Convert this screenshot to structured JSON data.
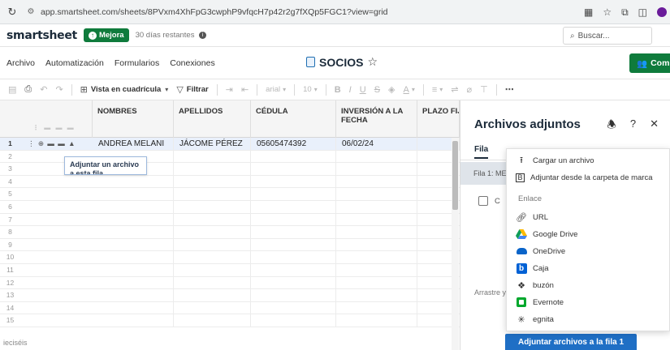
{
  "browser": {
    "reload_icon": "reload-icon",
    "url": "app.smartsheet.com/sheets/8PVxm4XhFpG3cwphP9vfqcH7p42r2g7fXQp5FGC1?view=grid"
  },
  "app": {
    "logo": "smartsheet",
    "upgrade_label": "Mejora",
    "trial_text": "30 días restantes",
    "search_placeholder": "Buscar..."
  },
  "menu": {
    "items": [
      "Archivo",
      "Automatización",
      "Formularios",
      "Conexiones"
    ],
    "sheet_title": "SOCIOS",
    "share_label": "Com"
  },
  "toolbar": {
    "view_label": "Vista en cuadrícula",
    "filter_label": "Filtrar",
    "font_name": "arial",
    "font_size": "10"
  },
  "grid": {
    "columns": [
      "NOMBRES",
      "APELLIDOS",
      "CÉDULA",
      "INVERSIÓN A LA FECHA",
      "PLAZO FIJO"
    ],
    "rows": [
      {
        "num": "1",
        "cells": [
          "ANDREA MELANI",
          "JÁCOME PÉREZ",
          "05605474392",
          "06/02/24",
          ""
        ]
      },
      {
        "num": "2",
        "cells": [
          "",
          "",
          "",
          "",
          ""
        ]
      },
      {
        "num": "3",
        "cells": [
          "",
          "",
          "",
          "",
          ""
        ]
      },
      {
        "num": "4",
        "cells": [
          "",
          "",
          "",
          "",
          ""
        ]
      },
      {
        "num": "5",
        "cells": [
          "",
          "",
          "",
          "",
          ""
        ]
      },
      {
        "num": "6",
        "cells": [
          "",
          "",
          "",
          "",
          ""
        ]
      },
      {
        "num": "7",
        "cells": [
          "",
          "",
          "",
          "",
          ""
        ]
      },
      {
        "num": "8",
        "cells": [
          "",
          "",
          "",
          "",
          ""
        ]
      },
      {
        "num": "9",
        "cells": [
          "",
          "",
          "",
          "",
          ""
        ]
      },
      {
        "num": "10",
        "cells": [
          "",
          "",
          "",
          "",
          ""
        ]
      },
      {
        "num": "11",
        "cells": [
          "",
          "",
          "",
          "",
          ""
        ]
      },
      {
        "num": "12",
        "cells": [
          "",
          "",
          "",
          "",
          ""
        ]
      },
      {
        "num": "13",
        "cells": [
          "",
          "",
          "",
          "",
          ""
        ]
      },
      {
        "num": "14",
        "cells": [
          "",
          "",
          "",
          "",
          ""
        ]
      },
      {
        "num": "15",
        "cells": [
          "",
          "",
          "",
          "",
          ""
        ]
      }
    ],
    "tooltip": "Adjuntar un archivo a esta fila",
    "bottom_label": "ieciséis"
  },
  "panel": {
    "title": "Archivos adjuntos",
    "tab_row": "Fila",
    "row_banner": "Fila 1: ME",
    "checkbox_label": "C",
    "drag_text": "Arrastre y",
    "attach_button": "Adjuntar archivos a la fila 1"
  },
  "dropdown": {
    "upload": "Cargar un archivo",
    "brand_folder": "Adjuntar desde la carpeta de marca",
    "link_section": "Enlace",
    "url": "URL",
    "google_drive": "Google Drive",
    "onedrive": "OneDrive",
    "box": "Caja",
    "dropbox": "buzón",
    "evernote": "Evernote",
    "egnyte": "egnita"
  },
  "colors": {
    "brand_green": "#0f7b3c",
    "accent_blue": "#1f6fc5",
    "active_row": "#e9f0fb"
  }
}
